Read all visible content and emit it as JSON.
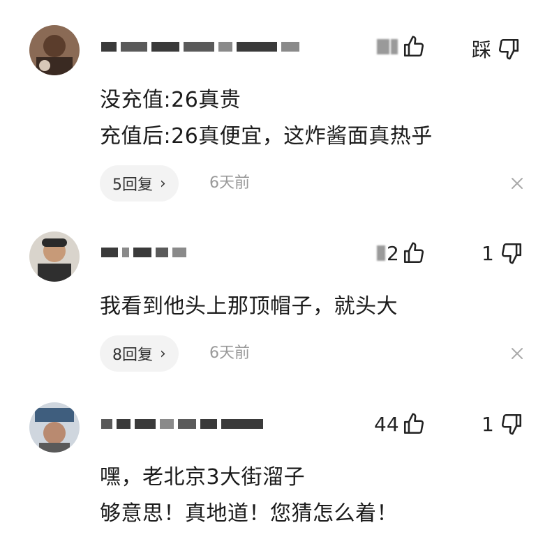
{
  "comments": [
    {
      "username": "",
      "likes": "",
      "dislike_label": "踩",
      "lines": [
        "没充值:26真贵",
        "充值后:26真便宜，这炸酱面真热乎"
      ],
      "replies_label": "5回复",
      "time": "6天前"
    },
    {
      "username": "",
      "likes": "2",
      "dislikes": "1",
      "lines": [
        "我看到他头上那顶帽子，就头大"
      ],
      "replies_label": "8回复",
      "time": "6天前"
    },
    {
      "username": "",
      "likes": "44",
      "dislikes": "1",
      "lines": [
        "嘿，老北京3大街溜子",
        "够意思！真地道！您猜怎么着！"
      ]
    }
  ],
  "icons": {
    "like": "thumbs-up-icon",
    "dislike": "thumbs-down-icon",
    "close": "close-icon",
    "chevron": "chevron-right-icon"
  }
}
